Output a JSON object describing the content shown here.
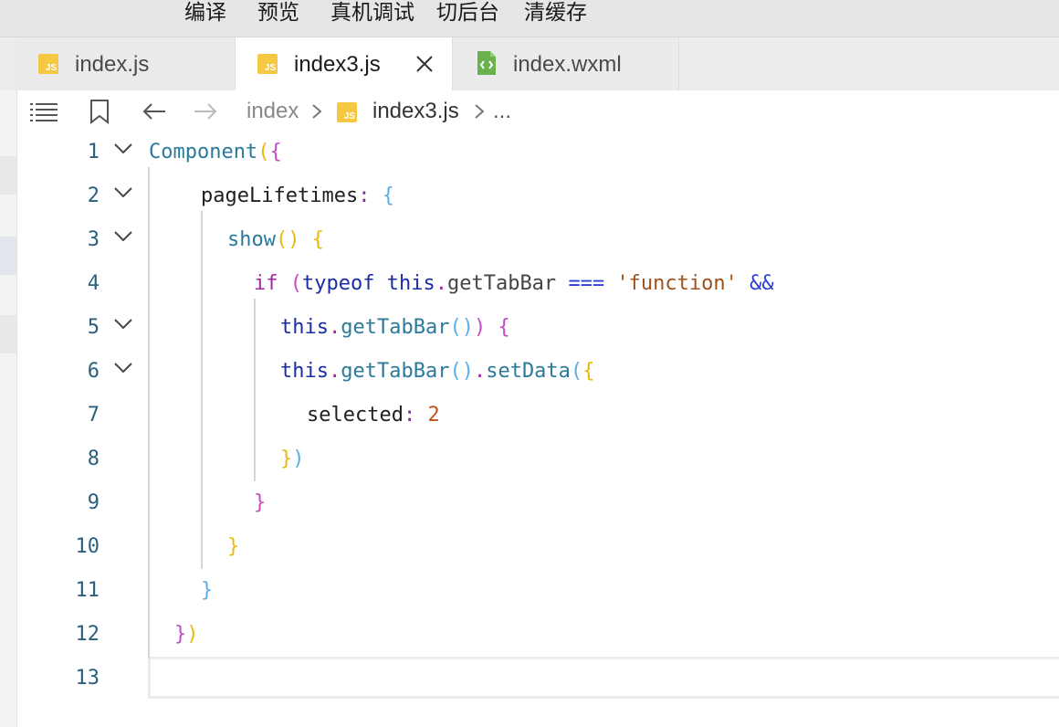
{
  "toolbar": {
    "compile": "编译",
    "preview": "预览",
    "remote_debug": "真机调试",
    "background": "切后台",
    "clear_cache": "清缓存"
  },
  "tabs": [
    {
      "label": "index.js",
      "icon": "js-file-icon",
      "active": false
    },
    {
      "label": "index3.js",
      "icon": "js-file-icon",
      "active": true
    },
    {
      "label": "index.wxml",
      "icon": "wxml-file-icon",
      "active": false
    }
  ],
  "breadcrumb": {
    "folder": "index",
    "file": "index3.js",
    "more": "..."
  },
  "editor": {
    "line_numbers": [
      "1",
      "2",
      "3",
      "4",
      "5",
      "6",
      "7",
      "8",
      "9",
      "10",
      "11",
      "12",
      "13"
    ],
    "fold_lines": [
      1,
      2,
      3,
      5,
      6
    ],
    "tokens": {
      "component": "Component",
      "pageLifetimes": "pageLifetimes",
      "show": "show",
      "if_kw": "if",
      "typeof_kw": "typeof",
      "this_kw": "this",
      "getTabBar": "getTabBar",
      "strict_eq": "===",
      "function_str": "'function'",
      "and_op": "&&",
      "setData": "setData",
      "selected": "selected",
      "selected_value": "2"
    }
  },
  "colors": {
    "accent_js": "#f5c842",
    "accent_wxml": "#6ab04c",
    "keyword": "#a626a4",
    "string": "#a0521a",
    "identifier": "#2a7a9b"
  }
}
